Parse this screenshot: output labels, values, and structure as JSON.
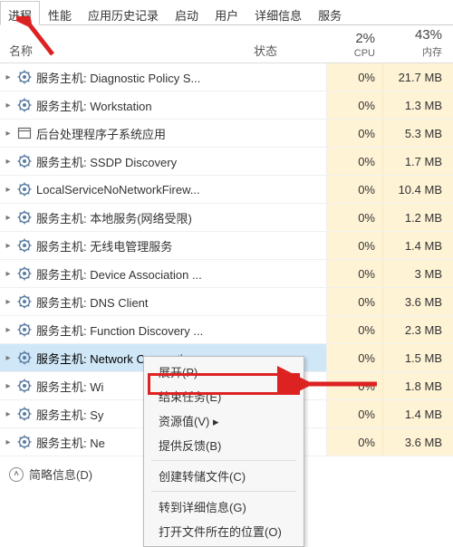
{
  "tabs": {
    "items": [
      "进程",
      "性能",
      "应用历史记录",
      "启动",
      "用户",
      "详细信息",
      "服务"
    ],
    "active": 0
  },
  "header": {
    "name_label": "名称",
    "status_label": "状态",
    "cpu_pct": "2%",
    "cpu_label": "CPU",
    "mem_pct": "43%",
    "mem_label": "内存"
  },
  "rows": [
    {
      "name": "服务主机: Diagnostic Policy S...",
      "cpu": "0%",
      "mem": "21.7 MB",
      "icon": "gear"
    },
    {
      "name": "服务主机: Workstation",
      "cpu": "0%",
      "mem": "1.3 MB",
      "icon": "gear"
    },
    {
      "name": "后台处理程序子系统应用",
      "cpu": "0%",
      "mem": "5.3 MB",
      "icon": "window"
    },
    {
      "name": "服务主机: SSDP Discovery",
      "cpu": "0%",
      "mem": "1.7 MB",
      "icon": "gear"
    },
    {
      "name": "LocalServiceNoNetworkFirew...",
      "cpu": "0%",
      "mem": "10.4 MB",
      "icon": "gear"
    },
    {
      "name": "服务主机: 本地服务(网络受限)",
      "cpu": "0%",
      "mem": "1.2 MB",
      "icon": "gear"
    },
    {
      "name": "服务主机: 无线电管理服务",
      "cpu": "0%",
      "mem": "1.4 MB",
      "icon": "gear"
    },
    {
      "name": "服务主机: Device Association ...",
      "cpu": "0%",
      "mem": "3 MB",
      "icon": "gear"
    },
    {
      "name": "服务主机: DNS Client",
      "cpu": "0%",
      "mem": "3.6 MB",
      "icon": "gear"
    },
    {
      "name": "服务主机: Function Discovery ...",
      "cpu": "0%",
      "mem": "2.3 MB",
      "icon": "gear"
    },
    {
      "name": "服务主机: Network Connecti...",
      "cpu": "0%",
      "mem": "1.5 MB",
      "icon": "gear",
      "selected": true
    },
    {
      "name": "服务主机: Wi",
      "cpu": "0%",
      "mem": "1.8 MB",
      "icon": "gear"
    },
    {
      "name": "服务主机: Sy",
      "cpu": "0%",
      "mem": "1.4 MB",
      "icon": "gear"
    },
    {
      "name": "服务主机: Ne",
      "cpu": "0%",
      "mem": "3.6 MB",
      "icon": "gear"
    }
  ],
  "context_menu": {
    "items": [
      {
        "label": "展开(P)"
      },
      {
        "label": "结束任务(E)",
        "highlighted": true
      },
      {
        "label": "资源值(V)",
        "submenu": true
      },
      {
        "label": "提供反馈(B)"
      },
      {
        "sep": true
      },
      {
        "label": "创建转储文件(C)"
      },
      {
        "sep": true
      },
      {
        "label": "转到详细信息(G)"
      },
      {
        "label": "打开文件所在的位置(O)"
      }
    ]
  },
  "footer": {
    "label": "简略信息(D)"
  }
}
